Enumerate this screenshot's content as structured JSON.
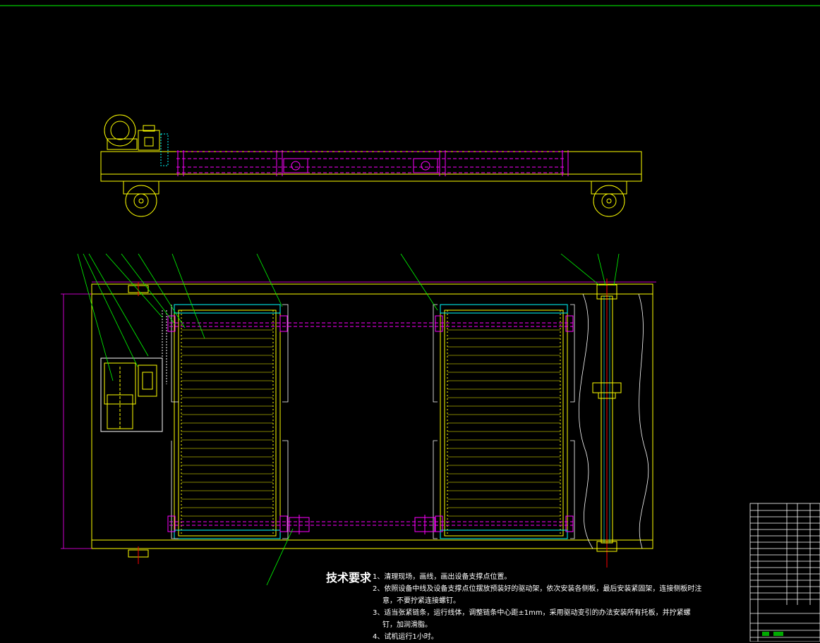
{
  "tech_requirements": {
    "title": "技术要求",
    "lines": [
      "1、清理现场，画线，画出设备支撑点位置。",
      "2、依照设备中线及设备支撑点位摆放预装好的驱动架，依次安装各侧板，最后安装紧固架，连接侧板时注",
      "意，不要拧紧连接螺钉。",
      "3、适当张紧链条，运行线体，调整链条中心距±1mm，采用驱动变引的办法安装所有托板，并拧紧螺",
      "钉，加润滑脂。",
      "4、试机运行1小时。"
    ]
  },
  "colors": {
    "background": "#000000",
    "frame": "#ffff00",
    "chain": "#ff00ff",
    "leader": "#00ff00",
    "shaft": "#ff0000",
    "slat": "#00ffff",
    "text": "#ffffff"
  }
}
